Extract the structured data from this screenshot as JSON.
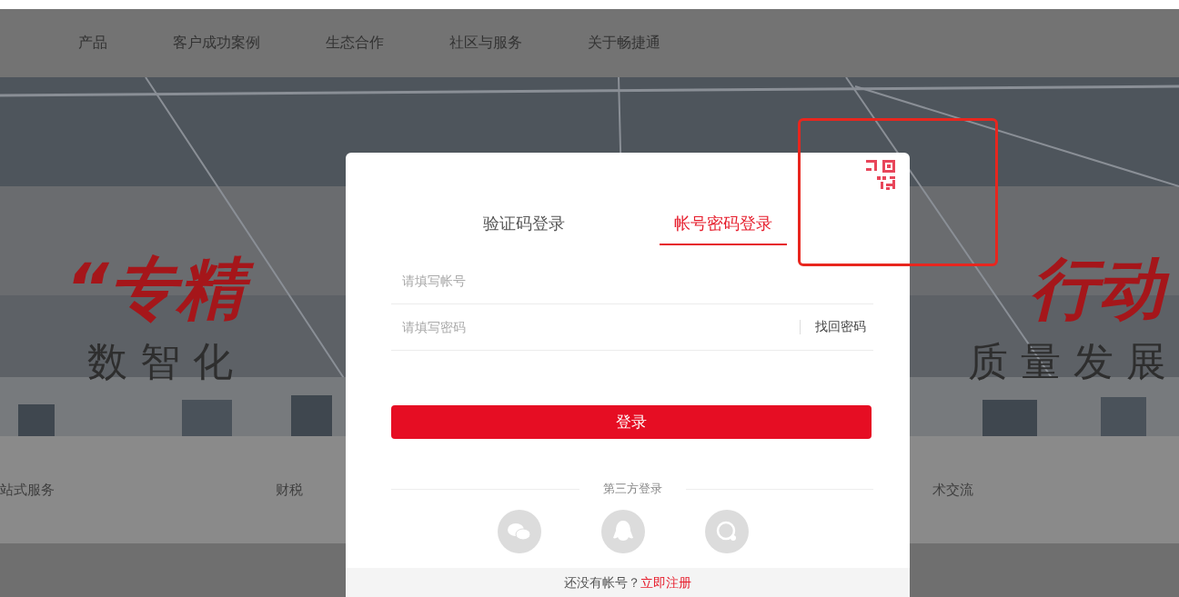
{
  "nav": {
    "items": [
      {
        "label": "产品"
      },
      {
        "label": "客户成功案例"
      },
      {
        "label": "生态合作"
      },
      {
        "label": "社区与服务"
      },
      {
        "label": "关于畅捷通"
      }
    ]
  },
  "banner": {
    "headline_left": "“专精",
    "headline_right": "行动",
    "subtitle_left": "数智化",
    "subtitle_right": "质量发展"
  },
  "services": [
    "站式服务",
    "财税",
    "术交流"
  ],
  "login": {
    "tabs": [
      {
        "label": "验证码登录",
        "selected": false
      },
      {
        "label": "帐号密码登录",
        "selected": true
      }
    ],
    "account_field": {
      "placeholder": "请填写帐号"
    },
    "password_field": {
      "placeholder": "请填写密码"
    },
    "forgot_link": "找回密码",
    "submit_button": "登录",
    "third_party_label": "第三方登录",
    "register_prompt": "还没有帐号？",
    "register_link": "立即注册"
  }
}
